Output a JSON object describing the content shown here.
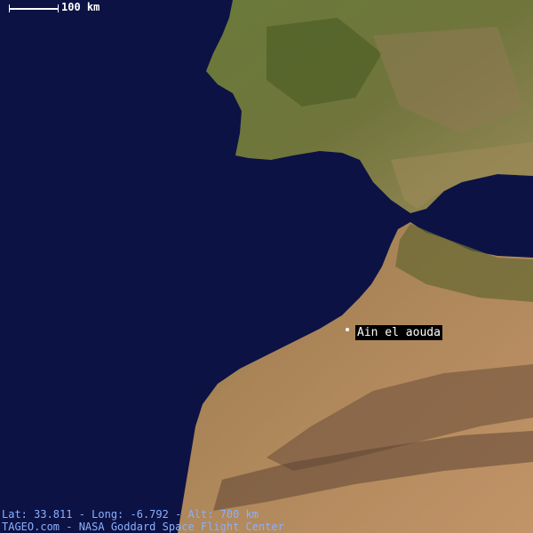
{
  "map": {
    "scale_label": "100 km",
    "place_label": "Ain el aouda",
    "coords_line": "Lat: 33.811 - Long: -6.792 - Alt: 700 km",
    "credit_line": "TAGEO.com -  NASA Goddard Space Flight Center",
    "colors": {
      "ocean": "#0c1244",
      "vegetation": "#5e6a2c",
      "desert": "#b58a5c",
      "mountains": "#8e6a4e",
      "label_text": "#ffffff",
      "footer_text": "#8ab0ff"
    }
  }
}
